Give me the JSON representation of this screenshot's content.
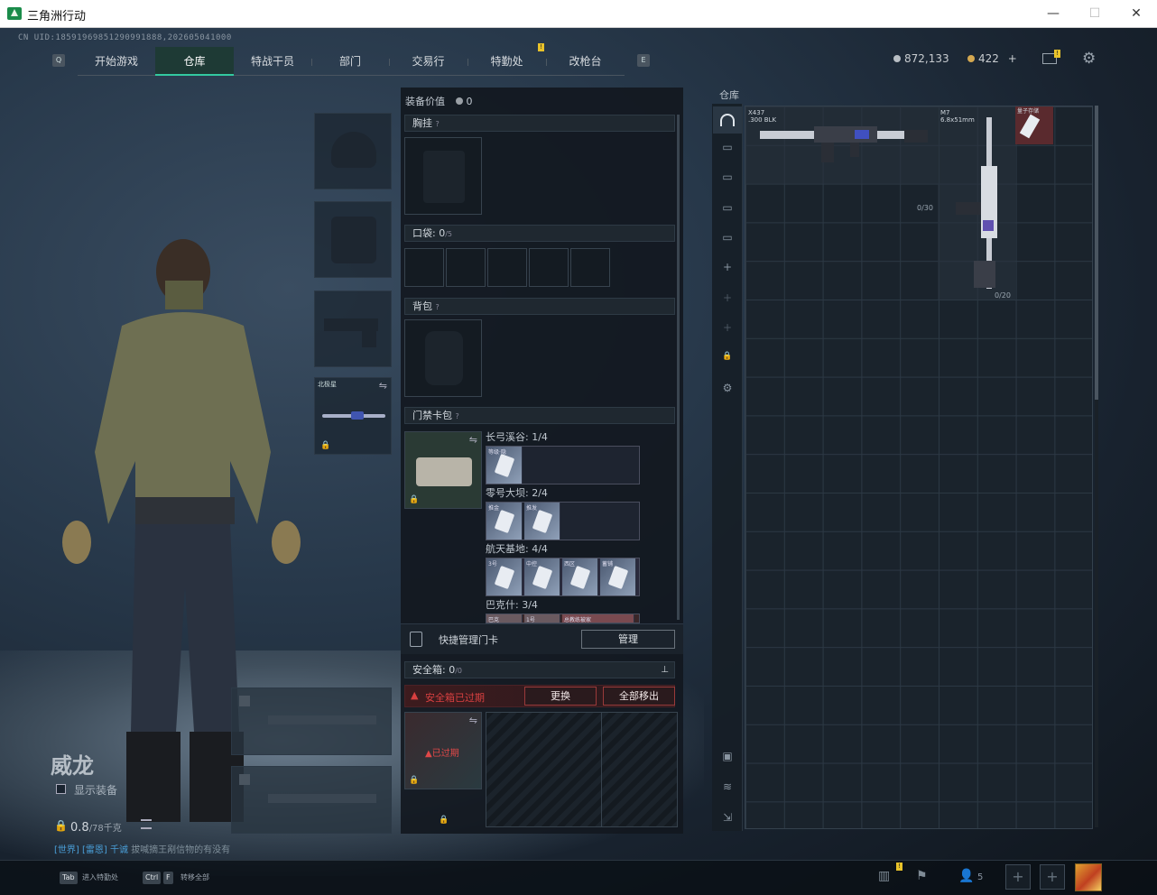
{
  "window": {
    "title": "三角洲行动",
    "minimize": "—",
    "maximize": "☐",
    "close": "✕"
  },
  "uid": "CN UID:18591969851290991888,202605041000",
  "nav": {
    "left_key": "Q",
    "right_key": "E",
    "tabs": [
      {
        "label": "开始游戏"
      },
      {
        "label": "仓库"
      },
      {
        "label": "特战干员"
      },
      {
        "label": "部门"
      },
      {
        "label": "交易行"
      },
      {
        "label": "特勤处"
      },
      {
        "label": "改枪台"
      }
    ],
    "active_tab": "仓库"
  },
  "currency": {
    "coins": "872,133",
    "tickets": "422",
    "plus": "+"
  },
  "character": {
    "name": "威龙",
    "show_equipment": "显示装备",
    "weight_value": "0.8",
    "weight_max": "/78千克",
    "hint_tag": "[世界]",
    "hint_tag2": "[雷恩] 千诚",
    "hint_text": "拔喊摘王剐信物的有没有"
  },
  "equipment": {
    "melee_label": "北极星"
  },
  "middle": {
    "equipment_value_label": "装备价值",
    "equipment_value": "0",
    "chest_rig": "胸挂",
    "pockets": "口袋:",
    "pockets_count": "0",
    "pockets_cap": "/5",
    "backpack": "背包",
    "keycard_bag": "门禁卡包",
    "maps": [
      {
        "name": "长弓溪谷: 1/4",
        "cards": [
          "等级·隐"
        ]
      },
      {
        "name": "零号大坝: 2/4",
        "cards": [
          "推金",
          "推发"
        ]
      },
      {
        "name": "航天基地: 4/4",
        "cards": [
          "3号",
          "中控",
          "西区",
          "蓄铺"
        ]
      },
      {
        "name": "巴克什: 3/4",
        "cards": [
          "巴克",
          "1号",
          "总教练被家"
        ]
      }
    ],
    "quick_manage": "快捷管理门卡",
    "manage_btn": "管理",
    "safebox_label": "安全箱:",
    "safebox_count": "0",
    "safebox_cap": "/0",
    "safebox_expired": "安全箱已过期",
    "replace_btn": "更换",
    "remove_all_btn": "全部移出",
    "expired_tag": "已过期"
  },
  "warehouse": {
    "label": "仓库",
    "items": [
      {
        "name": "X437",
        "caliber": ".300 BLK",
        "ammo": "0/30"
      },
      {
        "name": "M7",
        "caliber": "6.8x51mm",
        "ammo": "0/20"
      },
      {
        "name": "量子存储"
      }
    ]
  },
  "bottom": {
    "tab_key": "Tab",
    "tab_label": "进入特勤处",
    "ctrl_key": "Ctrl",
    "f_key": "F",
    "ctrl_label": "转移全部",
    "friends": "5"
  },
  "colors": {
    "accent": "#33c9a0",
    "warning": "#e8c22a",
    "danger": "#d84040"
  }
}
